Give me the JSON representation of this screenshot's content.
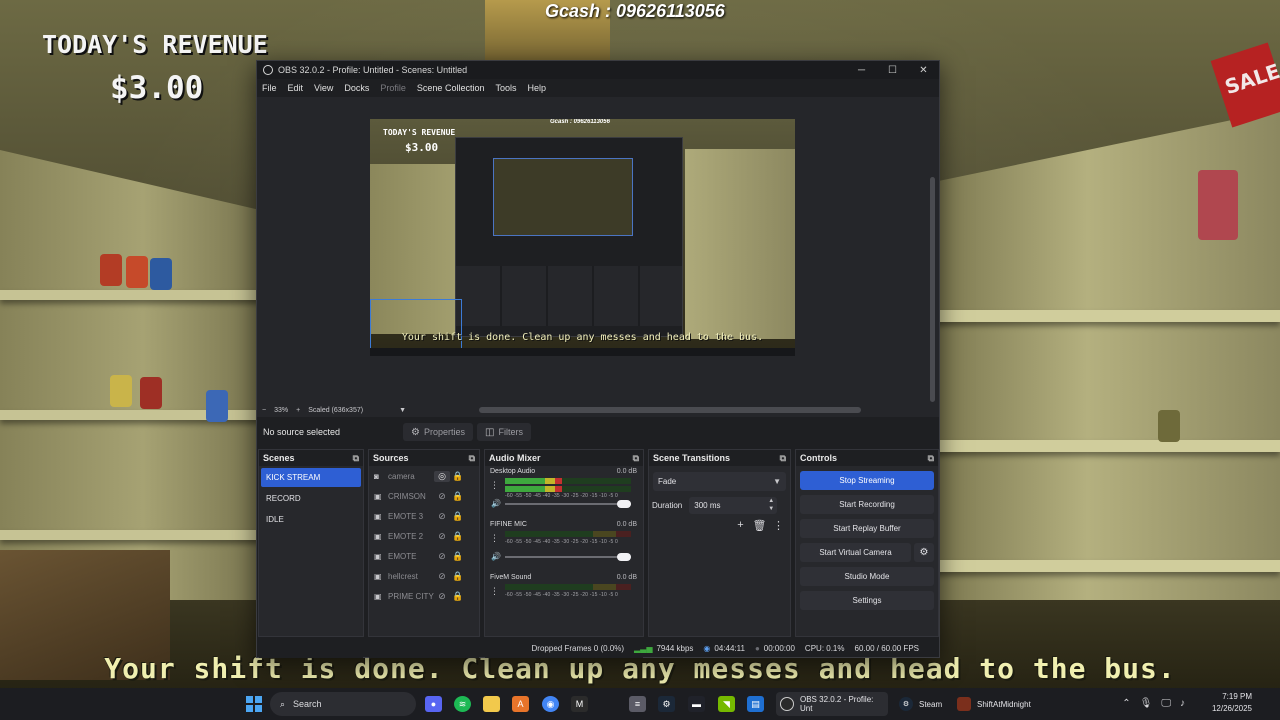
{
  "game": {
    "revenue_label": "TODAY'S REVENUE",
    "revenue_value": "$3.00",
    "gcash": "Gcash : 09626113056",
    "subtitle": "Your shift is done. Clean up any messes and head to the bus.",
    "sale_sign": "SALE"
  },
  "obs": {
    "title": "OBS 32.0.2 - Profile: Untitled - Scenes: Untitled",
    "window_buttons": {
      "minimize": "─",
      "maximize": "☐",
      "close": "✕"
    },
    "menu": [
      "File",
      "Edit",
      "View",
      "Docks",
      "Profile",
      "Scene Collection",
      "Tools",
      "Help"
    ],
    "preview": {
      "revenue_label": "TODAY'S REVENUE",
      "revenue_value": "$3.00",
      "gcash": "Gcash : 09626113056",
      "subtitle": "Your shift is done. Clean up any messes and head to the bus."
    },
    "zoom": {
      "minus": "−",
      "percent": "33%",
      "plus": "+",
      "mode": "Scaled (636x357)",
      "dropdown": "▼"
    },
    "source_bar": {
      "no_source": "No source selected",
      "properties": "Properties",
      "filters": "Filters"
    },
    "scenes": {
      "title": "Scenes",
      "items": [
        "KICK STREAM",
        "RECORD",
        "IDLE"
      ],
      "active_index": 0
    },
    "sources": {
      "title": "Sources",
      "items": [
        "camera",
        "CRIMSON",
        "EMOTE 3",
        "EMOTE 2",
        "EMOTE",
        "hellcrest",
        "PRIME CITY"
      ]
    },
    "mixer": {
      "title": "Audio Mixer",
      "channels": [
        {
          "name": "Desktop Audio",
          "db": "0.0 dB",
          "level": 0.45
        },
        {
          "name": "FIFINE MIC",
          "db": "0.0 dB",
          "level": 0.0
        },
        {
          "name": "FiveM Sound",
          "db": "0.0 dB",
          "level": 0.0
        }
      ],
      "scale": "-60 -55 -50 -45 -40 -35 -30 -25 -20 -15 -10 -5 0"
    },
    "transitions": {
      "title": "Scene Transitions",
      "selected": "Fade",
      "duration_label": "Duration",
      "duration_value": "300 ms"
    },
    "controls": {
      "title": "Controls",
      "stop_streaming": "Stop Streaming",
      "start_recording": "Start Recording",
      "start_replay": "Start Replay Buffer",
      "start_virtual": "Start Virtual Camera",
      "studio_mode": "Studio Mode",
      "settings": "Settings"
    },
    "status": {
      "dropped": "Dropped Frames 0 (0.0%)",
      "kbps": "7944 kbps",
      "stream_time": "04:44:11",
      "rec_time": "00:00:00",
      "cpu": "CPU: 0.1%",
      "fps": "60.00 / 60.00 FPS"
    }
  },
  "taskbar": {
    "search": "Search",
    "apps": [
      {
        "label": "OBS 32.0.2 - Profile: Unt"
      },
      {
        "label": "Steam"
      },
      {
        "label": "ShiftAtMidnight"
      }
    ],
    "time": "7:19 PM",
    "date": "12/26/2025"
  },
  "colors": {
    "accent": "#2e5fd4",
    "panel": "#27282c",
    "meter_green": "#3ea83e",
    "subtitle": "#f0efb0"
  }
}
